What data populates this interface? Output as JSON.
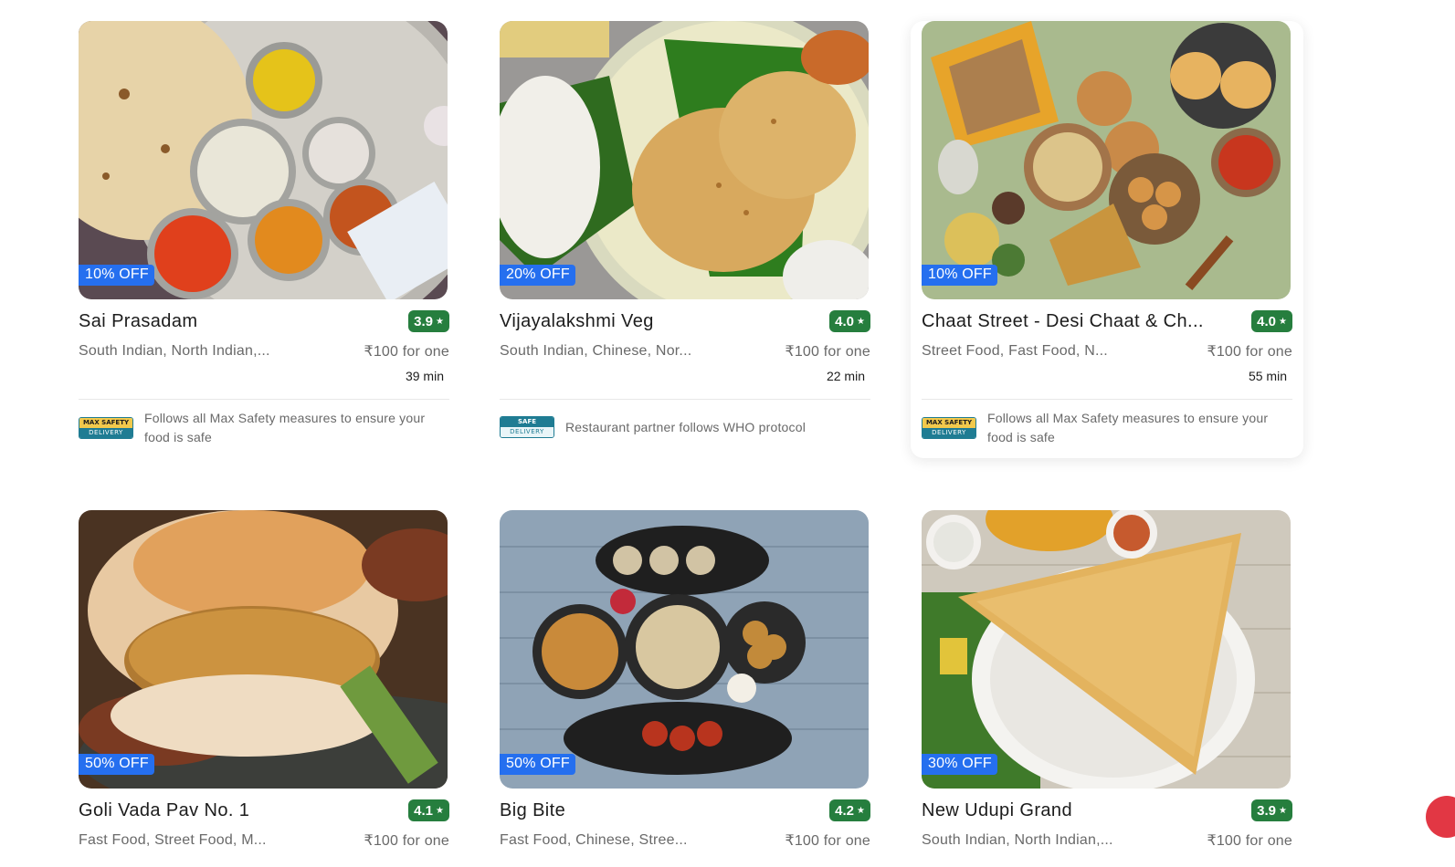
{
  "restaurants": [
    {
      "name": "Sai Prasadam",
      "offer": "10% OFF",
      "rating": "3.9",
      "cuisine": "South Indian, North Indian,...",
      "price": "₹100 for one",
      "time": "39 min",
      "safety_badge": {
        "top": "MAX SAFETY",
        "bottom": "DELIVERY"
      },
      "safety_text": "Follows all Max Safety measures to ensure your food is safe"
    },
    {
      "name": "Vijayalakshmi Veg",
      "offer": "20% OFF",
      "rating": "4.0",
      "cuisine": "South Indian, Chinese, Nor...",
      "price": "₹100 for one",
      "time": "22 min",
      "safety_badge": {
        "top": "SAFE",
        "bottom": "DELIVERY"
      },
      "safety_text": "Restaurant partner follows WHO protocol"
    },
    {
      "name": "Chaat Street - Desi Chaat & Ch...",
      "offer": "10% OFF",
      "rating": "4.0",
      "cuisine": "Street Food, Fast Food, N...",
      "price": "₹100 for one",
      "time": "55 min",
      "safety_badge": {
        "top": "MAX SAFETY",
        "bottom": "DELIVERY"
      },
      "safety_text": "Follows all Max Safety measures to ensure your food is safe"
    },
    {
      "name": "Goli Vada Pav No. 1",
      "offer": "50% OFF",
      "rating": "4.1",
      "cuisine": "Fast Food, Street Food, M...",
      "price": "₹100 for one"
    },
    {
      "name": "Big Bite",
      "offer": "50% OFF",
      "rating": "4.2",
      "cuisine": "Fast Food, Chinese, Stree...",
      "price": "₹100 for one"
    },
    {
      "name": "New Udupi Grand",
      "offer": "30% OFF",
      "rating": "3.9",
      "cuisine": "South Indian, North Indian,...",
      "price": "₹100 for one"
    }
  ],
  "colors": {
    "rating_green": "#267e3e",
    "offer_blue": "#256fef",
    "brand_red": "#e23744"
  },
  "icons": {
    "rating": "star-icon"
  }
}
